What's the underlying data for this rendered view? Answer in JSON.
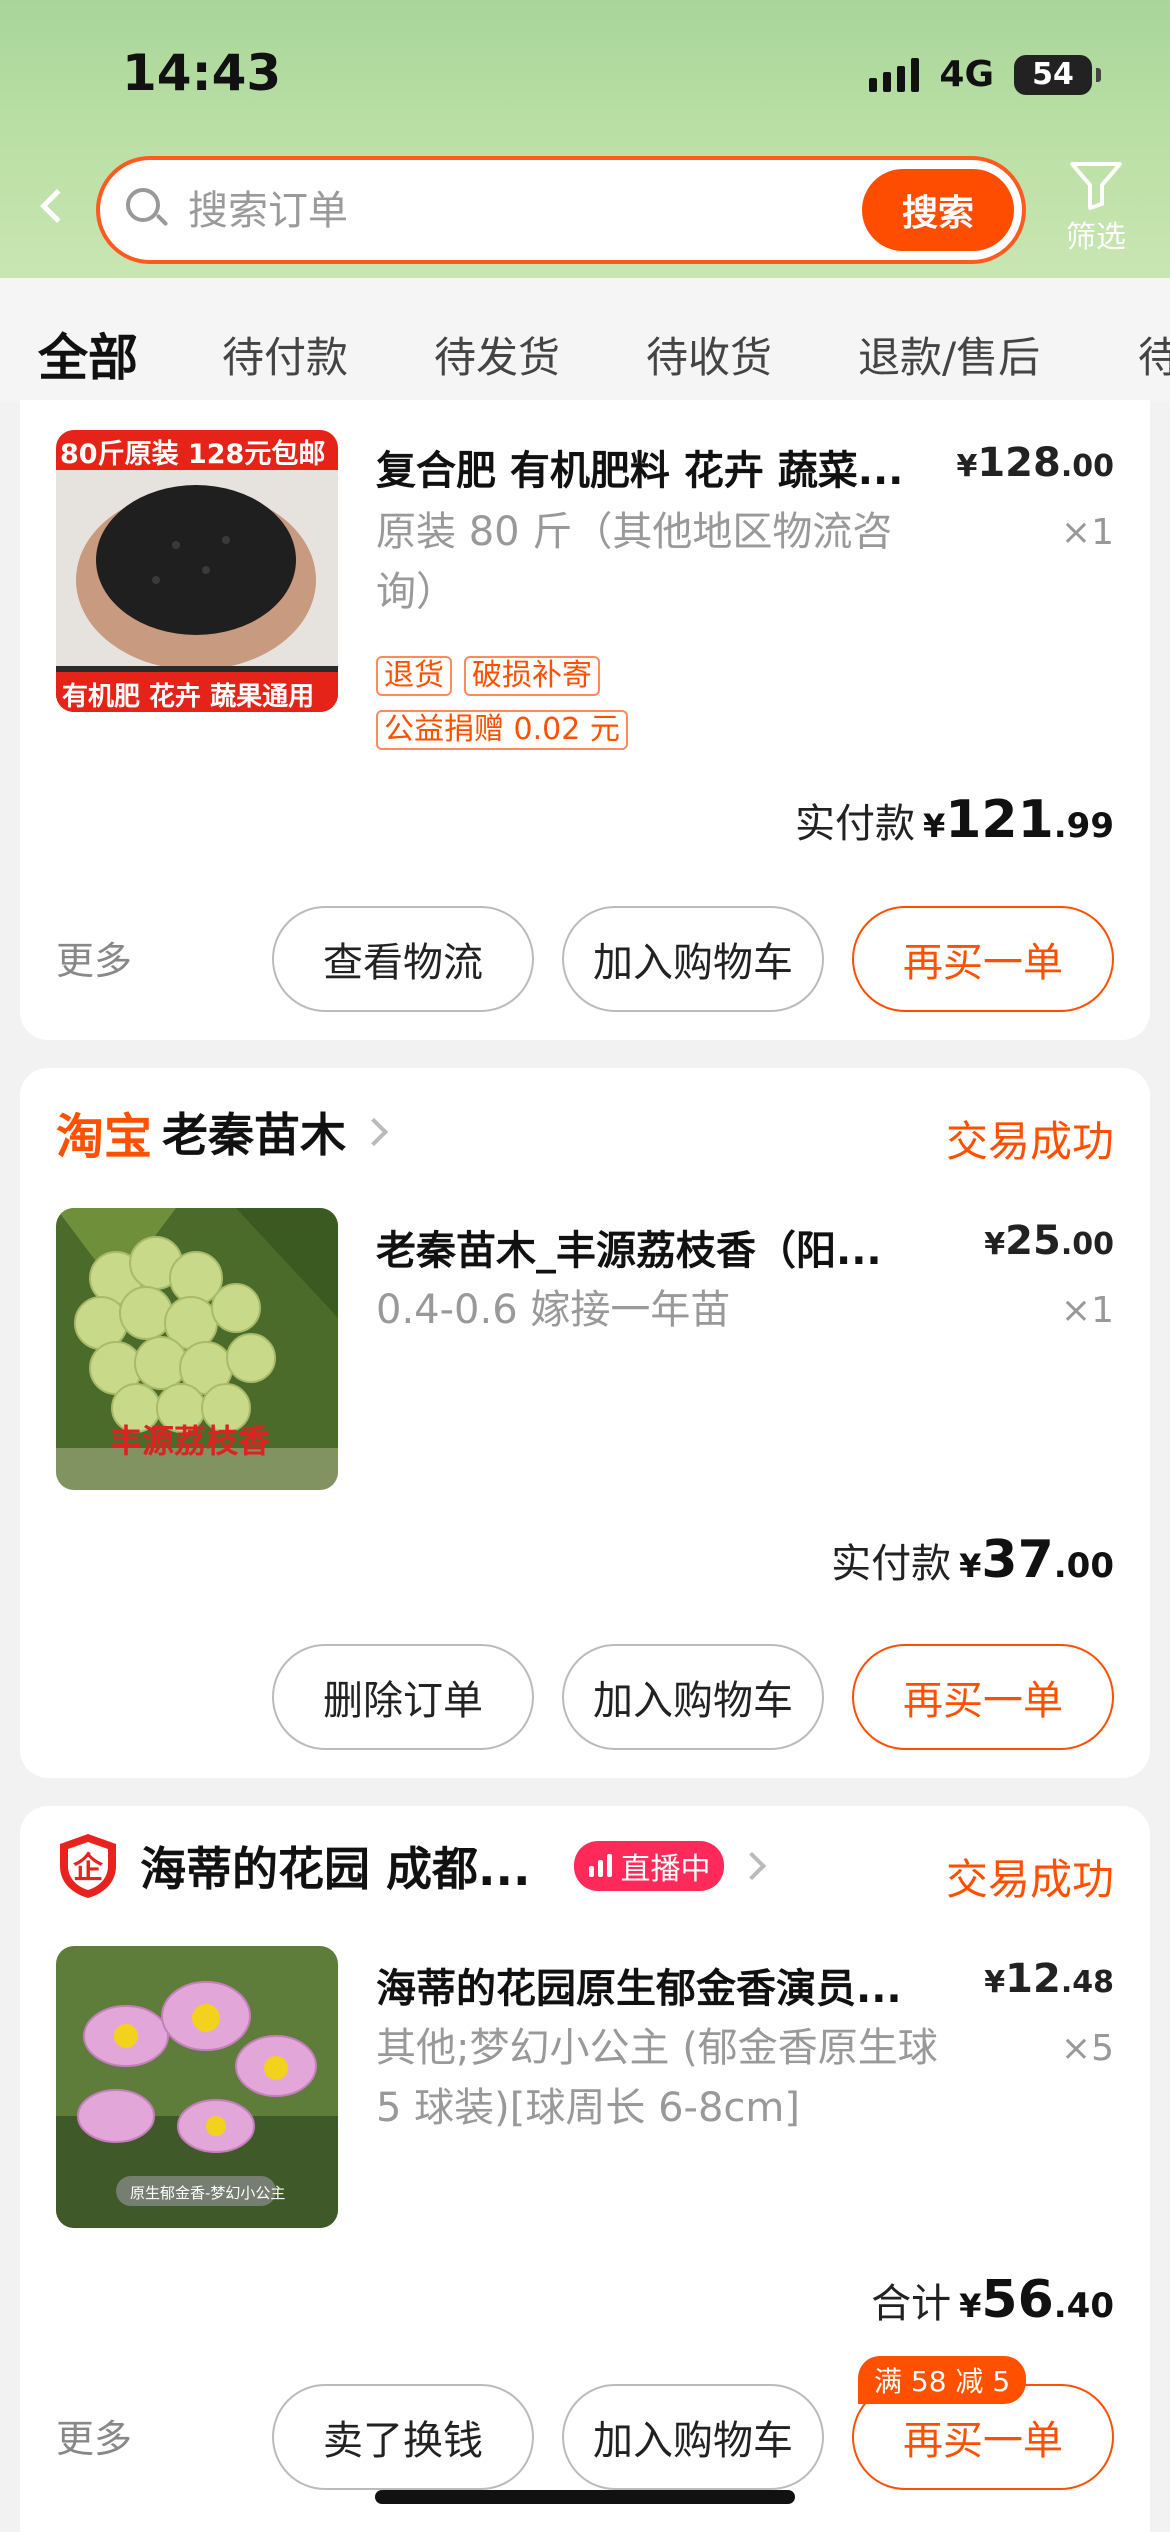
{
  "status_bar": {
    "time": "14:43",
    "network": "4G",
    "battery": "54"
  },
  "search": {
    "placeholder": "搜索订单",
    "button_label": "搜索",
    "filter_label": "筛选"
  },
  "tabs": [
    "全部",
    "待付款",
    "待发货",
    "待收货",
    "退款/售后",
    "待"
  ],
  "orders": [
    {
      "product": {
        "title": "复合肥 有机肥料 花卉 蔬菜...",
        "price_currency": "¥",
        "price_int": "128",
        "price_dec": ".00",
        "spec": "原装 80 斤（其他地区物流咨询）",
        "qty": "×1",
        "image_text_top": "80斤原装 128元包邮",
        "image_text_bottom": "有机肥 花卉 蔬果通用"
      },
      "tags": [
        "退货",
        "破损补寄",
        "公益捐赠 0.02 元"
      ],
      "paid_label": "实付款",
      "paid_currency": "¥",
      "paid_int": "121",
      "paid_dec": ".99",
      "more_label": "更多",
      "buttons": [
        "查看物流",
        "加入购物车",
        "再买一单"
      ]
    },
    {
      "platform": "淘宝",
      "shop": "老秦苗木",
      "status": "交易成功",
      "product": {
        "title": "老秦苗木_丰源荔枝香（阳...",
        "price_currency": "¥",
        "price_int": "25",
        "price_dec": ".00",
        "spec": "0.4-0.6 嫁接一年苗",
        "qty": "×1",
        "image_text": "丰源荔枝香"
      },
      "paid_label": "实付款",
      "paid_currency": "¥",
      "paid_int": "37",
      "paid_dec": ".00",
      "buttons": [
        "删除订单",
        "加入购物车",
        "再买一单"
      ]
    },
    {
      "shop": "海蒂的花园 成都...",
      "live_badge": "直播中",
      "status": "交易成功",
      "product": {
        "title": "海蒂的花园原生郁金香演员...",
        "price_currency": "¥",
        "price_int": "12",
        "price_dec": ".48",
        "spec": "其他;梦幻小公主 (郁金香原生球 5 球装)[球周长 6-8cm]",
        "qty": "×5",
        "image_text": "原生郁金香-梦幻小公主"
      },
      "paid_label": "合计",
      "paid_currency": "¥",
      "paid_int": "56",
      "paid_dec": ".40",
      "more_label": "更多",
      "promo": "满 58 减 5",
      "buttons": [
        "卖了换钱",
        "加入购物车",
        "再买一单"
      ]
    }
  ],
  "colors": {
    "accent": "#ff5000",
    "header_green": "#b9dfa4",
    "muted": "#999999"
  }
}
